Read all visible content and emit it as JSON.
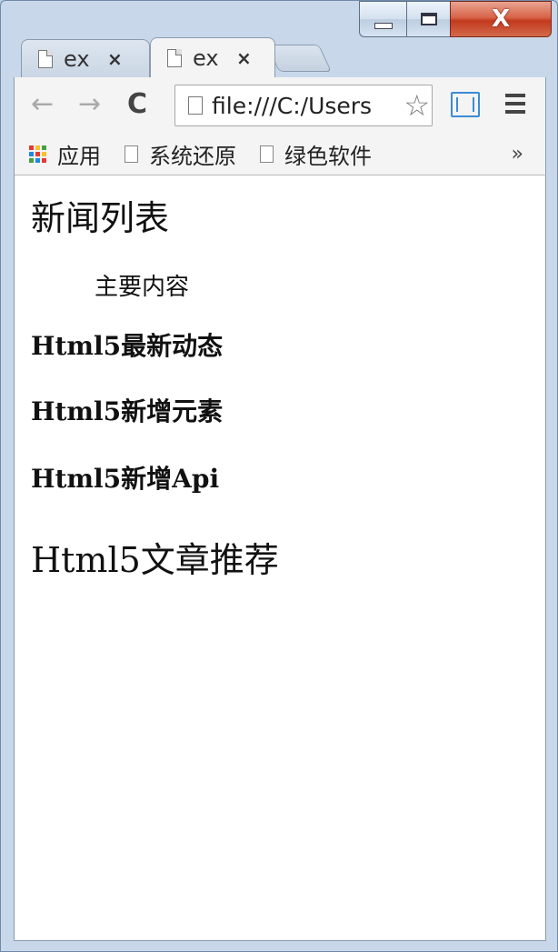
{
  "tabs": [
    {
      "title": "ex",
      "close": "×"
    },
    {
      "title": "ex",
      "close": "×"
    }
  ],
  "toolbar": {
    "back": "←",
    "forward": "→",
    "reload": "C",
    "url": "file:///C:/Users",
    "star": "☆"
  },
  "bookmarks": {
    "apps": "应用",
    "items": [
      "系统还原",
      "绿色软件"
    ],
    "more": "»"
  },
  "page": {
    "title": "新闻列表",
    "main_label": "主要内容",
    "news": [
      "Html5最新动态",
      "Html5新增元素",
      "Html5新增Api"
    ],
    "recommend": "Html5文章推荐"
  },
  "colors": {
    "apps_grid": [
      "#e53935",
      "#fbc02d",
      "#43a047",
      "#1e88e5",
      "#e53935",
      "#fbc02d",
      "#43a047",
      "#1e88e5",
      "#e53935"
    ]
  }
}
